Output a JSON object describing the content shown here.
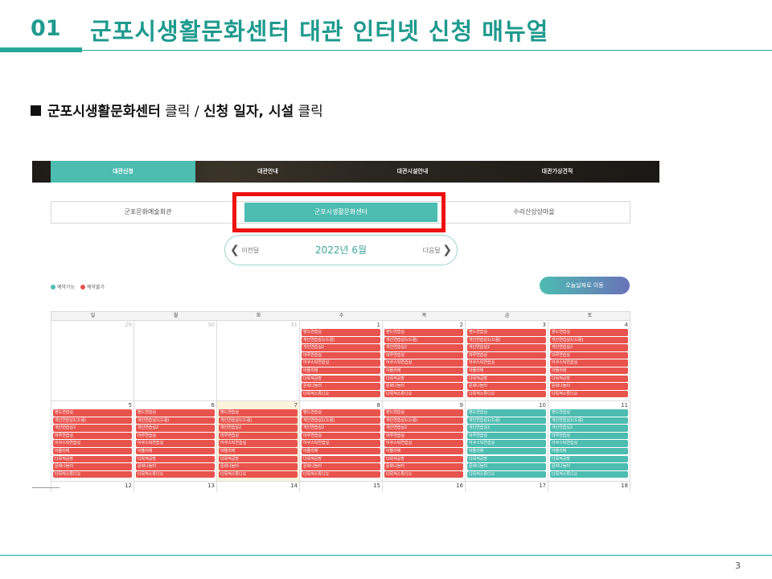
{
  "slide": {
    "number": "01",
    "title": "군포시생활문화센터 대관 인터넷 신청 매뉴얼",
    "page_number": "3"
  },
  "instruction": {
    "part1_bold": "군포시생활문화센터",
    "part2": " 클릭 / ",
    "part3_bold": "신청 일자, 시설",
    "part4": " 클릭"
  },
  "nav": {
    "tabs": [
      "대관신청",
      "대관안내",
      "대관시설안내",
      "대관가상견적"
    ],
    "active_index": 0
  },
  "venues": {
    "items": [
      "군포문화예술회관",
      "군포시생활문화센터",
      "수리산상상마을"
    ],
    "selected_index": 1
  },
  "month_nav": {
    "prev": "이전달",
    "label": "2022년 6월",
    "next": "다음달"
  },
  "legend": {
    "available": "예약가능",
    "unavailable": "예약불가",
    "available_color": "#4dbcb1",
    "unavailable_color": "#e8534d"
  },
  "today_button": "오늘날짜로 이동",
  "calendar": {
    "weekdays": [
      "일",
      "월",
      "화",
      "수",
      "목",
      "금",
      "토"
    ],
    "facilities": [
      "밴드연습실",
      "개인연습실1(드럼)",
      "개인연습실2",
      "마루연습실",
      "어쿠스틱연습실",
      "아뜰리에",
      "다목적공방",
      "문화나눔터",
      "다목적스튜디오"
    ],
    "weeks": [
      [
        {
          "day": "29",
          "other": true,
          "status": "none"
        },
        {
          "day": "30",
          "other": true,
          "status": "none"
        },
        {
          "day": "31",
          "other": true,
          "status": "none"
        },
        {
          "day": "1",
          "status": "red"
        },
        {
          "day": "2",
          "status": "red"
        },
        {
          "day": "3",
          "status": "red"
        },
        {
          "day": "4",
          "status": "red"
        }
      ],
      [
        {
          "day": "5",
          "status": "red"
        },
        {
          "day": "6",
          "status": "red"
        },
        {
          "day": "7",
          "status": "red",
          "today": true
        },
        {
          "day": "8",
          "status": "red"
        },
        {
          "day": "9",
          "status": "red"
        },
        {
          "day": "10",
          "status": "green"
        },
        {
          "day": "11",
          "status": "green"
        }
      ],
      [
        {
          "day": "12",
          "status": "none"
        },
        {
          "day": "13",
          "status": "none"
        },
        {
          "day": "14",
          "status": "none"
        },
        {
          "day": "15",
          "status": "none"
        },
        {
          "day": "16",
          "status": "none"
        },
        {
          "day": "17",
          "status": "none"
        },
        {
          "day": "18",
          "status": "none"
        }
      ]
    ]
  }
}
